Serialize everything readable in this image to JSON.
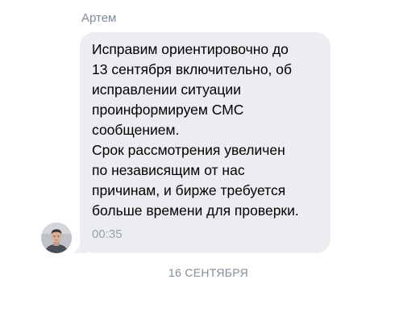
{
  "message": {
    "sender_name": "Артем",
    "text": "Исправим ориентировочно до\n13 сентября включительно, об\nисправлении ситуации\nпроинформируем СМС\nсообщением.\nСрок рассмотрения увеличен\nпо независящим от нас\nпричинам, и бирже требуется\nбольше времени для проверки.",
    "time": "00:35",
    "avatar_icon": "user-photo-avatar",
    "bubble_color": "#ebedf0"
  },
  "date_divider": {
    "label": "16 СЕНТЯБРЯ"
  }
}
